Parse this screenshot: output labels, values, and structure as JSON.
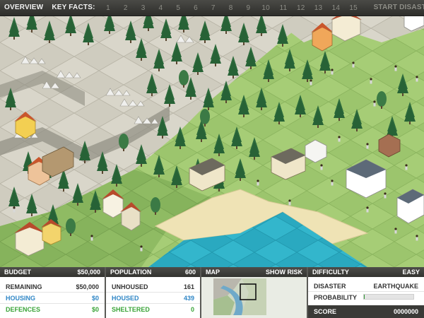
{
  "topbar": {
    "overview": "OVERVIEW",
    "key_facts": "KEY FACTS:",
    "fact_numbers": [
      "1",
      "2",
      "3",
      "4",
      "5",
      "6",
      "7",
      "8",
      "9",
      "10",
      "11",
      "12",
      "13",
      "14",
      "15"
    ],
    "start": "START DISASTER"
  },
  "budget": {
    "title": "BUDGET",
    "total": "$50,000",
    "remaining_label": "REMAINING",
    "remaining_value": "$50,000",
    "housing_label": "HOUSING",
    "housing_value": "$0",
    "defences_label": "DEFENCES",
    "defences_value": "$0"
  },
  "population": {
    "title": "POPULATION",
    "total": "600",
    "unhoused_label": "UNHOUSED",
    "unhoused_value": "161",
    "housed_label": "HOUSED",
    "housed_value": "439",
    "sheltered_label": "SHELTERED",
    "sheltered_value": "0"
  },
  "map": {
    "title": "MAP",
    "show_risk": "SHOW RISK"
  },
  "difficulty": {
    "title": "DIFFICULTY",
    "level": "EASY",
    "disaster_label": "DISASTER",
    "disaster_value": "EARTHQUAKE",
    "probability_label": "PROBABILITY",
    "probability": 0.02,
    "score_label": "SCORE",
    "score_value": "0000000"
  },
  "colors": {
    "grass": "#9bc46a",
    "grass_dark": "#7fae55",
    "rock": "#c9c6b8",
    "sand": "#efe3b5",
    "water": "#2fb0c6",
    "housing_blue": "#2f86c6",
    "defence_green": "#3aa438"
  }
}
